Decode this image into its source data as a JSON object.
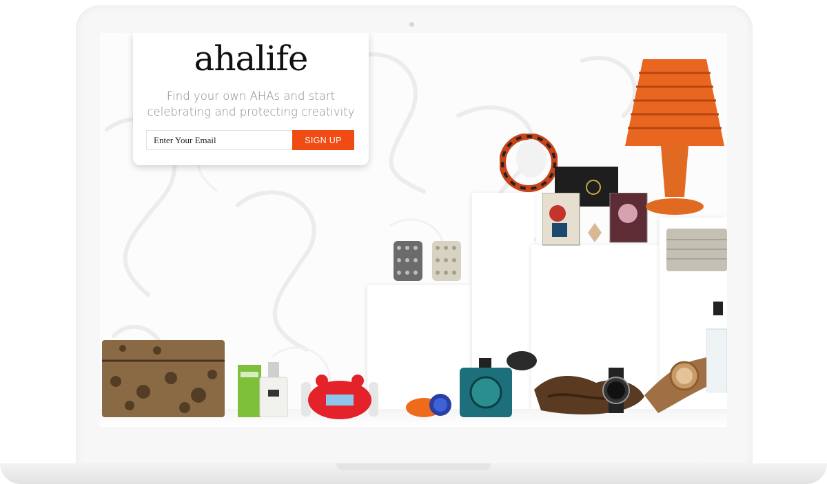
{
  "card": {
    "logo_aha": "aha",
    "logo_life": "life",
    "tagline": "Find your own AHAs and start celebrating and protecting creativity",
    "email_placeholder": "Enter Your Email",
    "signup_label": "SIGN UP"
  },
  "colors": {
    "accent": "#f04b13",
    "card_bg": "#ffffff",
    "frame": "#f7f7f7"
  },
  "products": [
    "snakeskin-clutch",
    "soap-box",
    "perfume-bottle",
    "red-alarm-clock",
    "orange-bangle",
    "blue-perfume-bottle",
    "driftwood",
    "black-watch",
    "wooden-watch",
    "glass-bottle",
    "rhinestone-cuff-dark",
    "rhinestone-cuff-light",
    "statement-necklace",
    "gift-box",
    "playing-cards",
    "orange-wicker-lamp",
    "silver-clutch"
  ]
}
